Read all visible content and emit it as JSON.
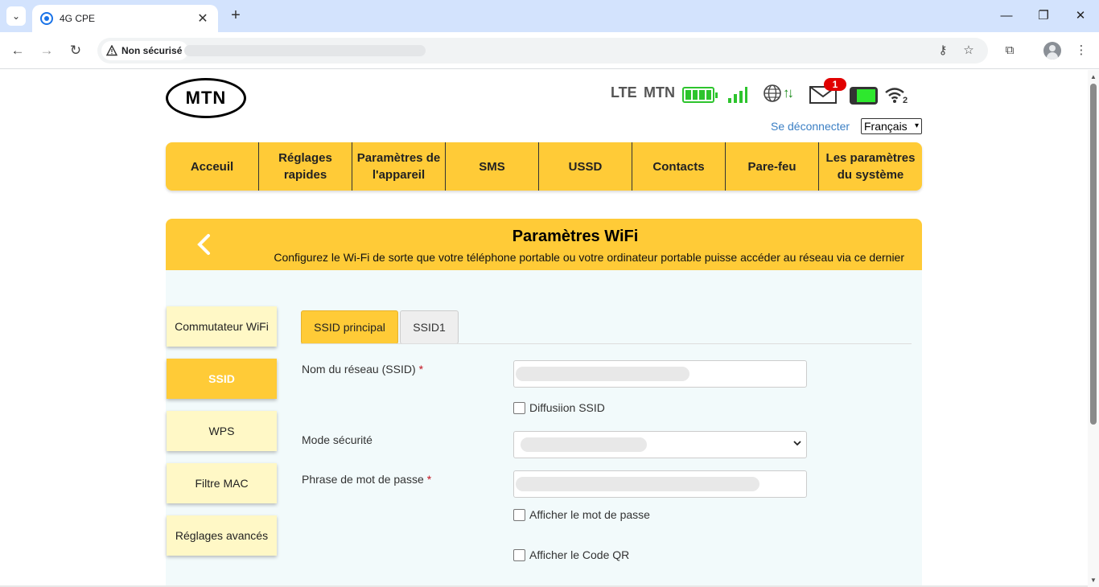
{
  "browser": {
    "tab_title": "4G CPE",
    "security_label": "Non sécurisé"
  },
  "header": {
    "logo_text": "MTN",
    "network_type": "LTE",
    "operator": "MTN",
    "unread_messages": "1",
    "wifi_clients": "2",
    "logout_label": "Se déconnecter",
    "language": "Français"
  },
  "menu": {
    "items": [
      {
        "label": "Acceuil"
      },
      {
        "label": "Réglages rapides"
      },
      {
        "label": "Paramètres de l'appareil"
      },
      {
        "label": "SMS"
      },
      {
        "label": "USSD"
      },
      {
        "label": "Contacts"
      },
      {
        "label": "Pare-feu"
      },
      {
        "label": "Les paramètres du système"
      }
    ]
  },
  "banner": {
    "title": "Paramètres WiFi",
    "subtitle": "Configurez le Wi-Fi de sorte que votre téléphone portable ou votre ordinateur portable puisse accéder au réseau via ce dernier"
  },
  "sidebar": {
    "items": [
      {
        "label": "Commutateur WiFi",
        "active": false
      },
      {
        "label": "SSID",
        "active": true
      },
      {
        "label": "WPS",
        "active": false
      },
      {
        "label": "Filtre MAC",
        "active": false
      },
      {
        "label": "Réglages avancés",
        "active": false
      }
    ]
  },
  "tabs": [
    {
      "label": "SSID principal",
      "active": true
    },
    {
      "label": "SSID1",
      "active": false
    }
  ],
  "form": {
    "ssid_label": "Nom du réseau (SSID)",
    "broadcast_label": "Diffusiion SSID",
    "security_mode_label": "Mode sécurité",
    "passphrase_label": "Phrase de mot de passe",
    "show_password_label": "Afficher le mot de passe",
    "show_qr_label": "Afficher le Code QR",
    "required_mark": "*"
  },
  "colors": {
    "brand_yellow": "#ffcb37",
    "status_green": "#2dc42d",
    "badge_red": "#e10000",
    "link_blue": "#3b7fc4"
  },
  "icons": [
    "chevron-down-icon",
    "close-icon",
    "plus-icon",
    "back-icon",
    "forward-icon",
    "reload-icon",
    "warning-icon",
    "key-icon",
    "star-icon",
    "extension-icon",
    "menu-icon",
    "battery-icon",
    "signal-icon",
    "globe-icon",
    "updown-arrows-icon",
    "mail-icon",
    "sim-icon",
    "wifi-icon",
    "chevron-left-icon"
  ]
}
